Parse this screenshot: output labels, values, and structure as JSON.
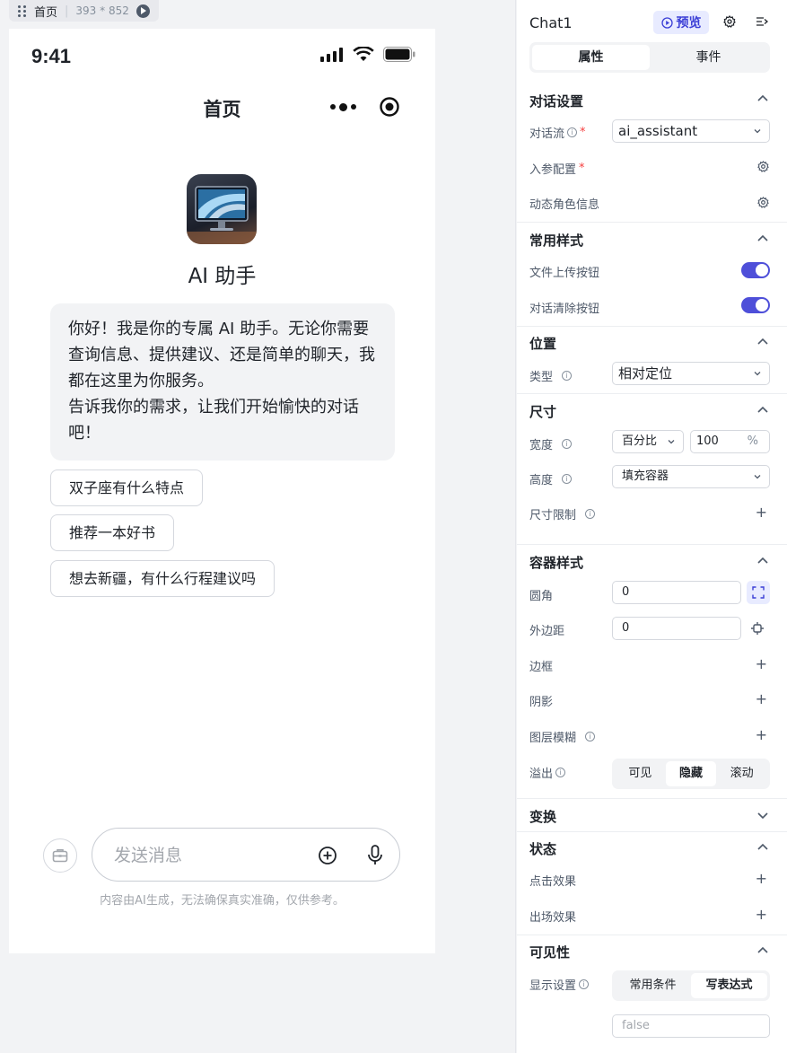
{
  "page_tag": {
    "name": "首页",
    "size": "393 * 852"
  },
  "phone": {
    "time": "9:41",
    "nav_title": "首页",
    "assistant_name": "AI 助手",
    "greeting_lines": [
      "你好！我是你的专属 AI 助手。无论你需要查询信息、提供建议、还是简单的聊天，我都在这里为你服务。",
      "告诉我你的需求，让我们开始愉快的对话吧！"
    ],
    "suggestions": [
      "双子座有什么特点",
      "推荐一本好书",
      "想去新疆，有什么行程建议吗"
    ],
    "input_placeholder": "发送消息",
    "disclaimer": "内容由AI生成，无法确保真实准确，仅供参考。"
  },
  "panel": {
    "title": "Chat1",
    "preview_label": "预览",
    "tabs": [
      "属性",
      "事件"
    ],
    "dialog_section": {
      "title": "对话设置",
      "flow_label": "对话流",
      "flow_value": "ai_assistant",
      "input_params_label": "入参配置",
      "dynamic_role_label": "动态角色信息"
    },
    "style_section": {
      "title": "常用样式",
      "upload_label": "文件上传按钮",
      "clear_label": "对话清除按钮"
    },
    "position_section": {
      "title": "位置",
      "type_label": "类型",
      "type_value": "相对定位"
    },
    "size_section": {
      "title": "尺寸",
      "width_label": "宽度",
      "width_mode": "百分比",
      "width_value": "100",
      "width_unit": "%",
      "height_label": "高度",
      "height_value": "填充容器",
      "limit_label": "尺寸限制"
    },
    "container_section": {
      "title": "容器样式",
      "radius_label": "圆角",
      "radius_value": "0",
      "margin_label": "外边距",
      "margin_value": "0",
      "border_label": "边框",
      "shadow_label": "阴影",
      "blur_label": "图层模糊",
      "overflow_label": "溢出",
      "overflow_options": [
        "可见",
        "隐藏",
        "滚动"
      ]
    },
    "transform_section": {
      "title": "变换"
    },
    "state_section": {
      "title": "状态",
      "click_label": "点击效果",
      "enter_label": "出场效果"
    },
    "visibility_section": {
      "title": "可见性",
      "display_label": "显示设置",
      "display_options": [
        "常用条件",
        "写表达式"
      ],
      "expression_value": "false"
    }
  }
}
